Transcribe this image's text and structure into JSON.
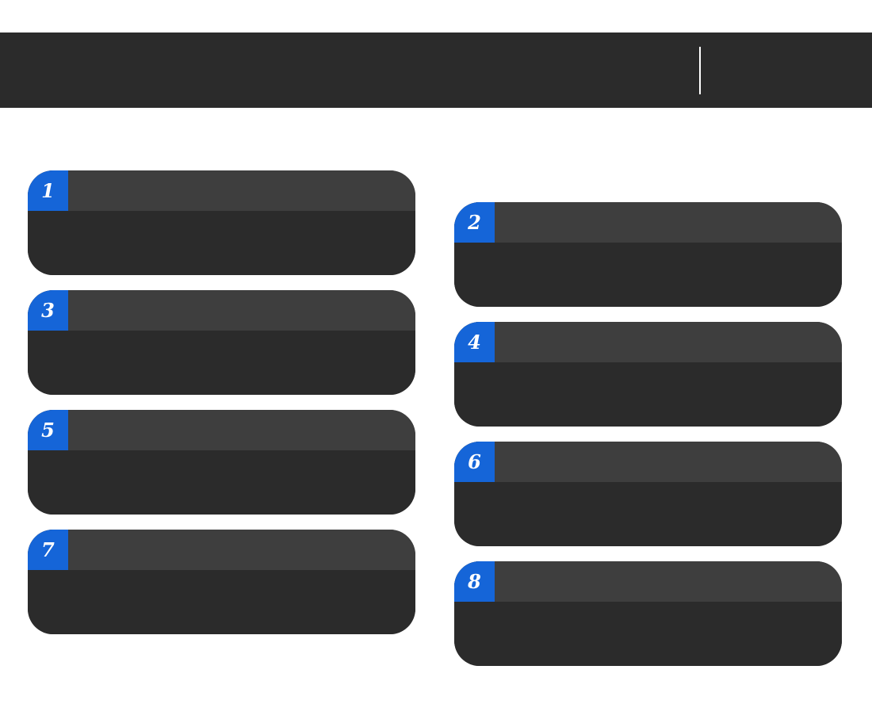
{
  "cards": [
    {
      "number": "1"
    },
    {
      "number": "2"
    },
    {
      "number": "3"
    },
    {
      "number": "4"
    },
    {
      "number": "5"
    },
    {
      "number": "6"
    },
    {
      "number": "7"
    },
    {
      "number": "8"
    }
  ],
  "colors": {
    "banner": "#2b2b2b",
    "card_header": "#3e3e3e",
    "card_body": "#2b2b2b",
    "badge": "#1565d8",
    "divider": "#ffffff"
  }
}
